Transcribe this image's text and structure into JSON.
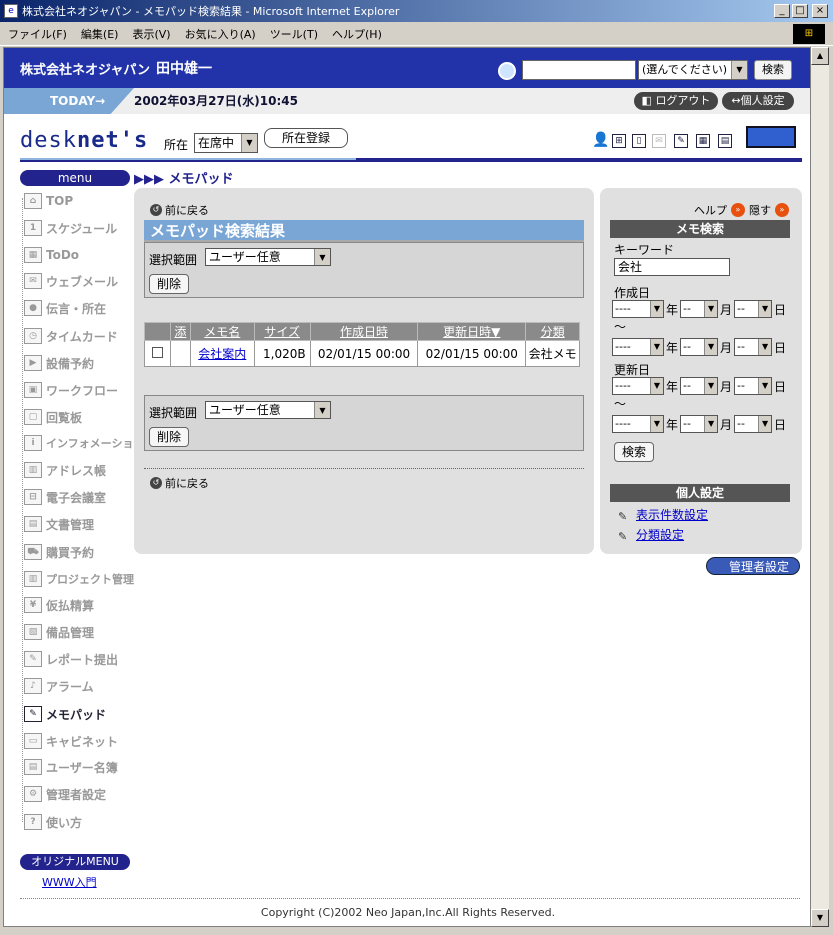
{
  "window": {
    "title": "株式会社ネオジャパン - メモパッド検索結果 - Microsoft Internet Explorer",
    "menu": [
      "ファイル(F)",
      "編集(E)",
      "表示(V)",
      "お気に入り(A)",
      "ツール(T)",
      "ヘルプ(H)"
    ]
  },
  "header": {
    "company": "株式会社ネオジャパン",
    "user": "田中雄一",
    "search_placeholder": "",
    "search_select": "(選んでください)",
    "search_button": "検索",
    "today_label": "TODAY→",
    "today_text": "2002年03月27日(水)10:45",
    "logout": "ログアウト",
    "personal_settings": "個人設定"
  },
  "toolbar": {
    "logo_a": "desk",
    "logo_b": "net's",
    "presence_label": "所在",
    "presence_value": "在席中",
    "presence_register": "所在登録"
  },
  "menu": {
    "header": "menu",
    "items": [
      "TOP",
      "スケジュール",
      "ToDo",
      "ウェブメール",
      "伝言・所在",
      "タイムカード",
      "設備予約",
      "ワークフロー",
      "回覧板",
      "インフォメーション",
      "アドレス帳",
      "電子会議室",
      "文書管理",
      "購買予約",
      "プロジェクト管理",
      "仮払精算",
      "備品管理",
      "レポート提出",
      "アラーム",
      "メモパッド",
      "キャビネット",
      "ユーザー名簿",
      "管理者設定",
      "使い方"
    ],
    "original_header": "オリジナルMENU",
    "original_link": "WWW入門"
  },
  "main": {
    "breadcrumb": "▶▶▶ メモパッド",
    "back": "前に戻る",
    "title": "メモパッド検索結果",
    "range_label": "選択範囲",
    "range_value": "ユーザー任意",
    "delete": "削除",
    "columns": [
      "添",
      "メモ名",
      "サイズ",
      "作成日時",
      "更新日時▼",
      "分類"
    ],
    "rows": [
      {
        "attach": "",
        "name": "会社案内",
        "size": "1,020B",
        "created": "02/01/15 00:00",
        "updated": "02/01/15 00:00",
        "category": "会社メモ"
      }
    ]
  },
  "side": {
    "help": "ヘルプ",
    "hide": "隠す",
    "search_header": "メモ検索",
    "keyword_label": "キーワード",
    "keyword_value": "会社",
    "created_label": "作成日",
    "updated_label": "更新日",
    "tilde": "～",
    "year_sel": "----",
    "md_sel": "--",
    "year": "年",
    "month": "月",
    "day": "日",
    "search_button": "検索",
    "personal_header": "個人設定",
    "link_display": "表示件数設定",
    "link_category": "分類設定"
  },
  "admin_button": "管理者設定",
  "copyright": "Copyright (C)2002 Neo Japan,Inc.All Rights Reserved."
}
